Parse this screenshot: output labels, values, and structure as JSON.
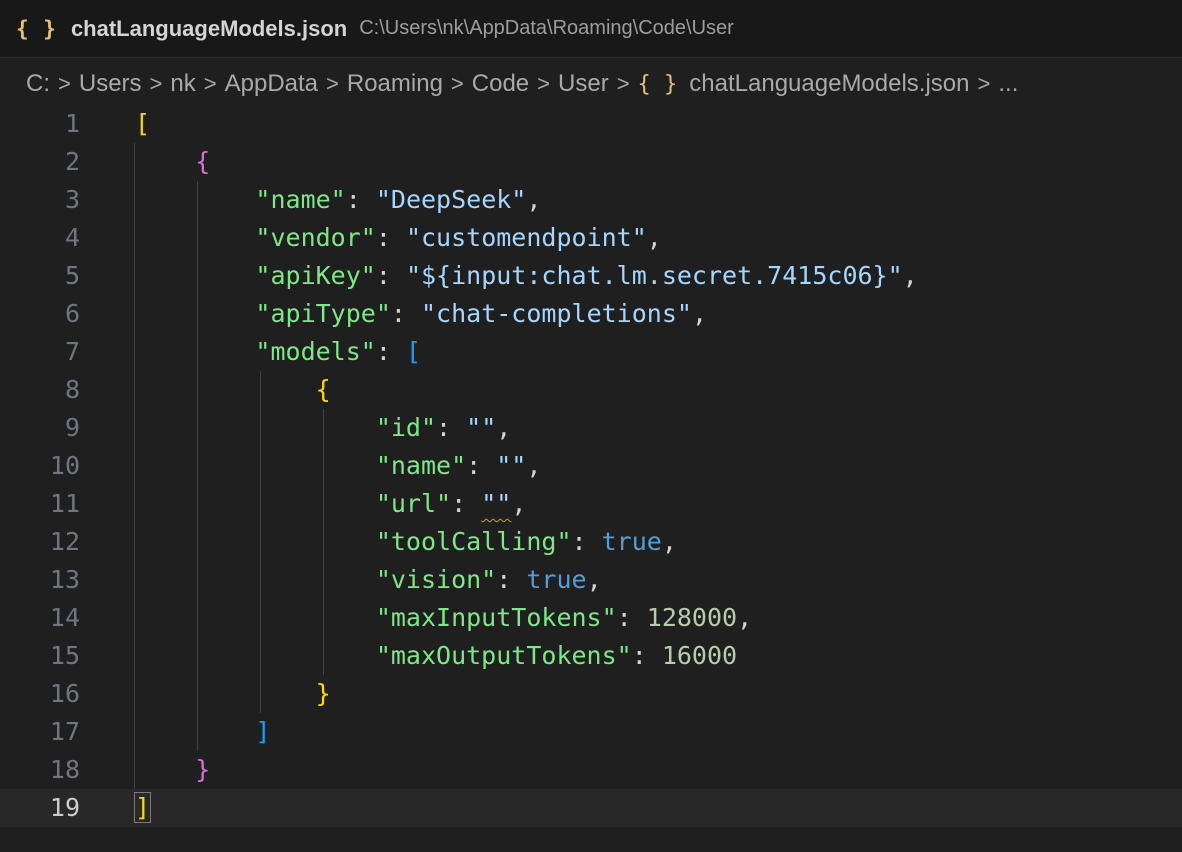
{
  "window": {
    "file_icon": "{ }",
    "file_name": "chatLanguageModels.json",
    "file_path": "C:\\Users\\nk\\AppData\\Roaming\\Code\\User"
  },
  "breadcrumb": {
    "items": [
      "C:",
      "Users",
      "nk",
      "AppData",
      "Roaming",
      "Code",
      "User"
    ],
    "file_icon": "{ }",
    "file_name": "chatLanguageModels.json",
    "tail": "..."
  },
  "editor": {
    "current_line": 19,
    "line_numbers": [
      "1",
      "2",
      "3",
      "4",
      "5",
      "6",
      "7",
      "8",
      "9",
      "10",
      "11",
      "12",
      "13",
      "14",
      "15",
      "16",
      "17",
      "18",
      "19"
    ],
    "json_fields": {
      "name": "DeepSeek",
      "vendor": "customendpoint",
      "apiKey": "${input:chat.lm.secret.7415c06}",
      "apiType": "chat-completions",
      "model_id": "",
      "model_name": "",
      "model_url": "",
      "toolCalling": "true",
      "vision": "true",
      "maxInputTokens": "128000",
      "maxOutputTokens": "16000"
    },
    "keys": {
      "name": "\"name\"",
      "vendor": "\"vendor\"",
      "apiKey": "\"apiKey\"",
      "apiType": "\"apiType\"",
      "models": "\"models\"",
      "id": "\"id\"",
      "model_name": "\"name\"",
      "url": "\"url\"",
      "toolCalling": "\"toolCalling\"",
      "vision": "\"vision\"",
      "maxInputTokens": "\"maxInputTokens\"",
      "maxOutputTokens": "\"maxOutputTokens\""
    },
    "values": {
      "name": "\"DeepSeek\"",
      "vendor": "\"customendpoint\"",
      "apiKey": "\"${input:chat.lm.secret.7415c06}\"",
      "apiType": "\"chat-completions\"",
      "id": "\"\"",
      "model_name": "\"\"",
      "url": "\"\"",
      "toolCalling": "true",
      "vision": "true",
      "maxInputTokens": "128000",
      "maxOutputTokens": "16000"
    }
  },
  "colors": {
    "background": "#1f1f1f",
    "key": "#7ee787",
    "string": "#a5d6ff",
    "number": "#b5cea8",
    "boolean": "#569cd6",
    "bracket_level1": "#ffd700",
    "bracket_level2": "#da70d6",
    "bracket_level3": "#179fff"
  }
}
